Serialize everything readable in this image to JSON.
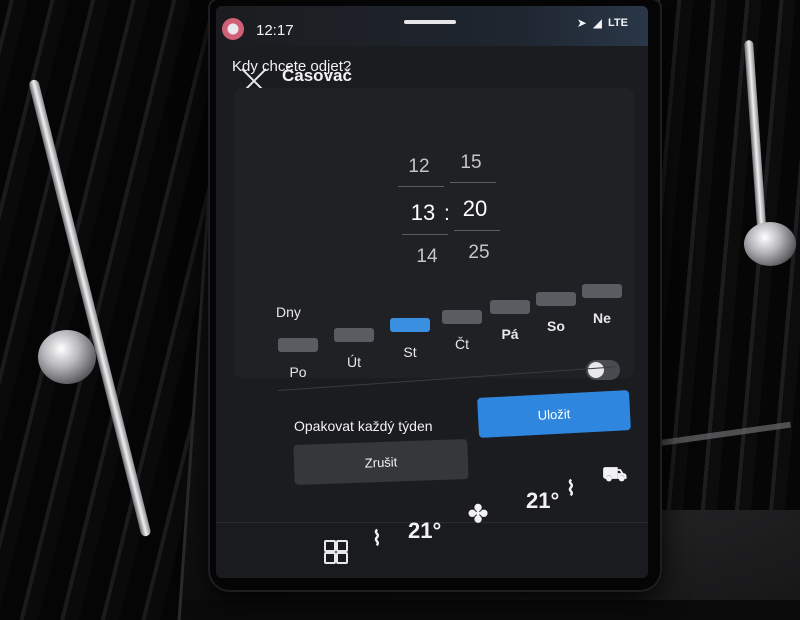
{
  "status_bar": {
    "time": "12:17",
    "network": "LTE"
  },
  "header": {
    "title": "Časovač"
  },
  "timer": {
    "question": "Kdy chcete odjet?",
    "hours": [
      "12",
      "13",
      "14"
    ],
    "minutes": [
      "15",
      "20",
      "25"
    ],
    "separator": ":"
  },
  "days": {
    "label": "Dny",
    "items": [
      {
        "label": "Po",
        "active": false
      },
      {
        "label": "Út",
        "active": false
      },
      {
        "label": "St",
        "active": true
      },
      {
        "label": "Čt",
        "active": false
      },
      {
        "label": "Pá",
        "active": false
      },
      {
        "label": "So",
        "active": false
      },
      {
        "label": "Ne",
        "active": false
      }
    ]
  },
  "repeat": {
    "label": "Opakovat každý týden",
    "enabled": false
  },
  "buttons": {
    "save": "Uložit",
    "cancel": "Zrušit"
  },
  "climate": {
    "left_temp": "21°",
    "right_temp": "21°"
  },
  "colors": {
    "accent": "#2e86de",
    "active_day": "#3a8fe0",
    "screen_bg": "#1b1c1f"
  }
}
